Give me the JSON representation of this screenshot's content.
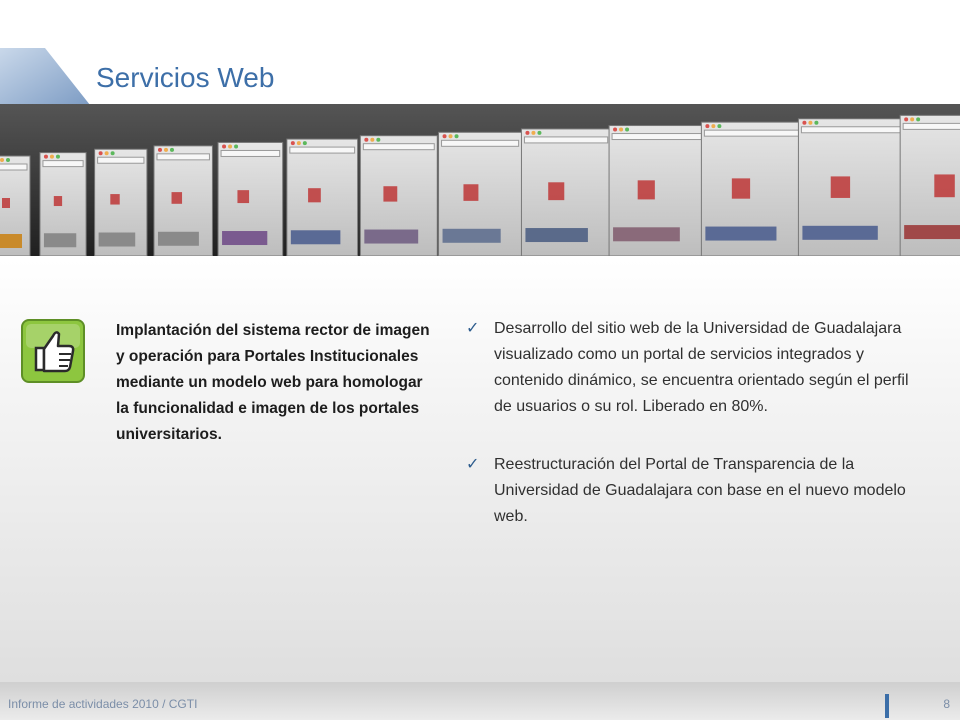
{
  "slide": {
    "title": "Servicios Web",
    "left_text": "Implantación del sistema rector de imagen y operación para Portales Institucionales mediante un modelo web para homologar la funcionalidad e imagen de los portales universitarios.",
    "bullets": [
      "Desarrollo del sitio web de la Universidad de Guadalajara visualizado como un portal de servicios integrados y contenido dinámico, se encuentra orientado según el perfil de usuarios o su rol. Liberado en 80%.",
      "Reestructuración del Portal de Transparencia de la Universidad de Guadalajara con base en el nuevo modelo web."
    ],
    "check_glyph": "✓",
    "thumbs_icon": "thumbs-up-icon"
  },
  "footer": {
    "text": "Informe de actividades 2010 / CGTI",
    "page_number": "8"
  },
  "colors": {
    "accent": "#3d6fa8",
    "icon_green": "#8dc63f"
  }
}
